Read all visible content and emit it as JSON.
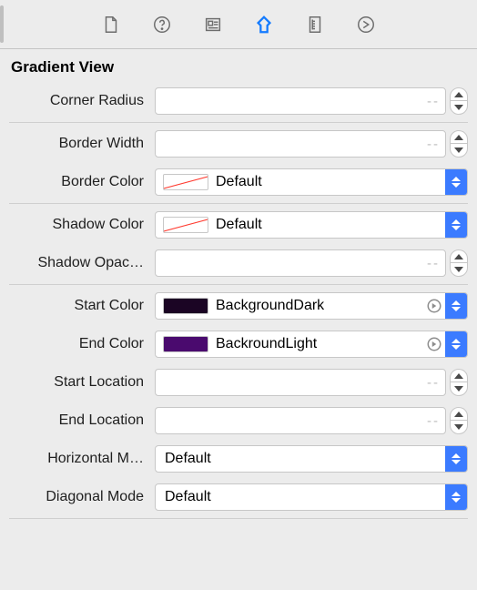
{
  "section_title": "Gradient View",
  "placeholder": "--",
  "labels": {
    "corner_radius": "Corner Radius",
    "border_width": "Border Width",
    "border_color": "Border Color",
    "shadow_color": "Shadow Color",
    "shadow_opacity": "Shadow Opac…",
    "start_color": "Start Color",
    "end_color": "End Color",
    "start_location": "Start Location",
    "end_location": "End Location",
    "horizontal_mode": "Horizontal M…",
    "diagonal_mode": "Diagonal Mode"
  },
  "values": {
    "corner_radius": "",
    "border_width": "",
    "border_color_name": "Default",
    "shadow_color_name": "Default",
    "shadow_opacity": "",
    "start_color_name": "BackgroundDark",
    "end_color_name": "BackroundLight",
    "start_location": "",
    "end_location": "",
    "horizontal_mode": "Default",
    "diagonal_mode": "Default"
  },
  "colors": {
    "start": "#1b0524",
    "end": "#4a0a6e"
  }
}
